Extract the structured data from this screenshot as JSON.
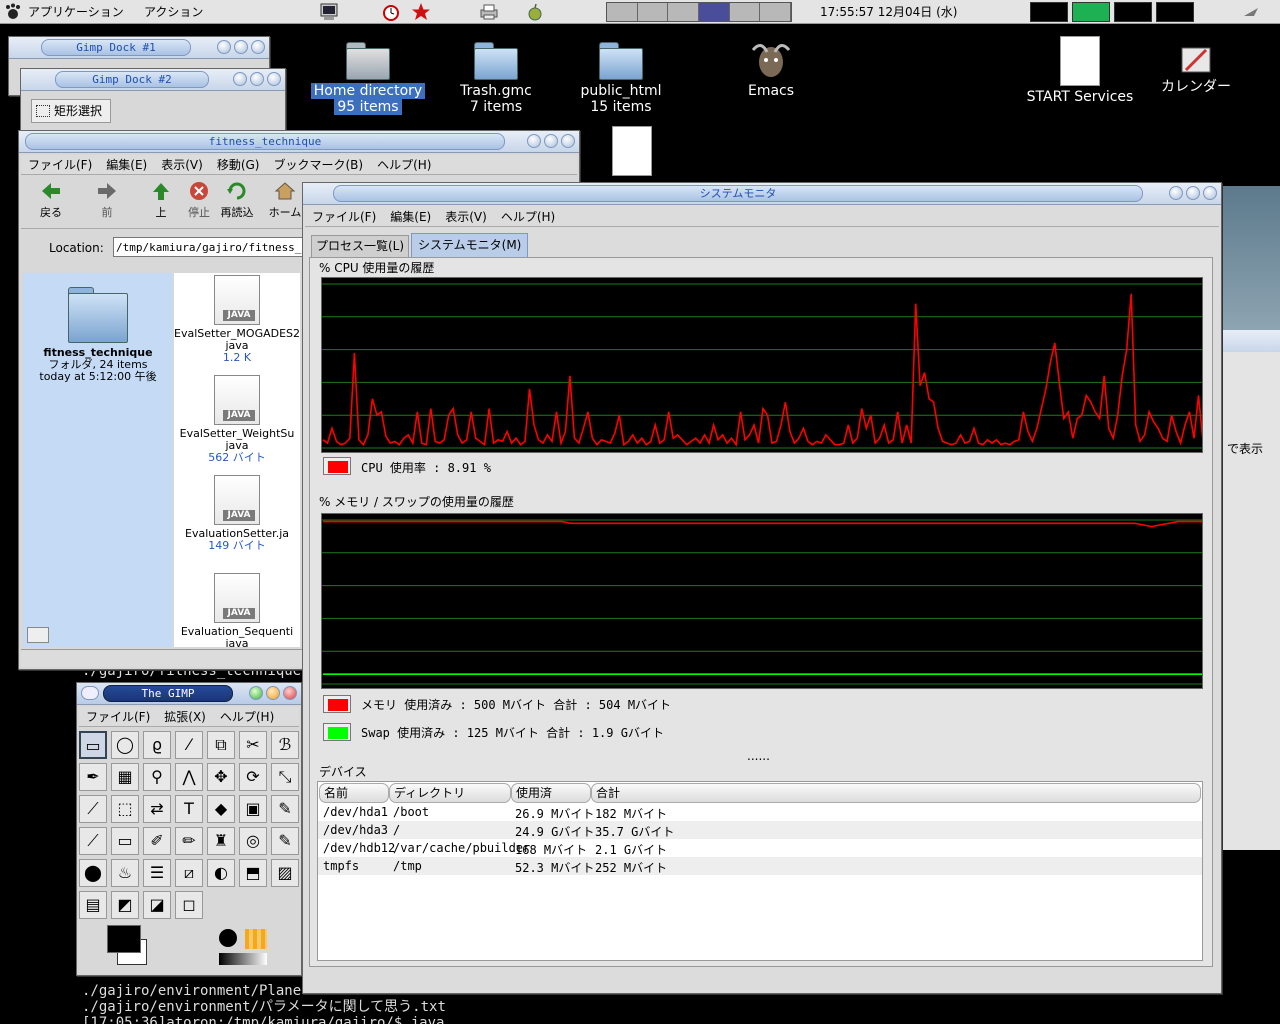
{
  "panel": {
    "applications": "アプリケーション",
    "actions": "アクション",
    "clock": "17:55:57 12月04日 (水)"
  },
  "desktop": {
    "icons": [
      {
        "name": "Home directory",
        "sub": "95 items"
      },
      {
        "name": "Trash.gmc",
        "sub": "7 items"
      },
      {
        "name": "public_html",
        "sub": "15 items"
      },
      {
        "name": "Emacs"
      },
      {
        "name": "START Services"
      },
      {
        "name": "カレンダー"
      }
    ],
    "bg_text_right": "で表示"
  },
  "gimp_dock_1": {
    "title": "Gimp Dock #1"
  },
  "gimp_dock_2": {
    "title": "Gimp Dock #2",
    "tool_label": "矩形選択"
  },
  "file_manager": {
    "title": "fitness_technique",
    "menu": [
      "ファイル(F)",
      "編集(E)",
      "表示(V)",
      "移動(G)",
      "ブックマーク(B)",
      "ヘルプ(H)"
    ],
    "toolbar": [
      "戻る",
      "前",
      "上",
      "停止",
      "再読込",
      "ホーム"
    ],
    "location_label": "Location:",
    "location_value": "/tmp/kamiura/gajiro/fitness_technique",
    "folder": {
      "name": "fitness_technique",
      "line1": "フォルダ, 24 items",
      "line2": "today at 5:12:00 午後"
    },
    "files": [
      {
        "name": "EvalSetter_MOGADES2",
        "ext": "java",
        "size": "1.2 K"
      },
      {
        "name": "EvalSetter_WeightSu",
        "ext": "java",
        "size": "562 バイト"
      },
      {
        "name": "EvaluationSetter.ja",
        "ext": "",
        "size": "149 バイト"
      },
      {
        "name": "Evaluation_Sequenti",
        "ext": "java",
        "size": ""
      }
    ],
    "java_badge": "JAVA"
  },
  "sysmon": {
    "title": "システムモニタ",
    "menu": [
      "ファイル(F)",
      "編集(E)",
      "表示(V)",
      "ヘルプ(H)"
    ],
    "tabs": [
      "プロセス一覧(L)",
      "システムモニタ(M)"
    ],
    "cpu_section": "% CPU 使用量の履歴",
    "cpu_legend": "CPU 使用率 : 8.91 %",
    "mem_section": "% メモリ / スワップの使用量の履歴",
    "mem_legend": "メモリ 使用済み : 500 Mバイト 合計 : 504 Mバイト",
    "swap_legend": "Swap 使用済み : 125 Mバイト 合計 : 1.9 Gバイト",
    "dots": "......",
    "devices_section": "デバイス",
    "columns": [
      "名前",
      "ディレクトリ",
      "使用済",
      "合計"
    ],
    "rows": [
      [
        "/dev/hda1",
        "/boot",
        "26.9 Mバイト",
        "182 Mバイト"
      ],
      [
        "/dev/hda3",
        "/",
        "24.9 Gバイト",
        "35.7 Gバイト"
      ],
      [
        "/dev/hdb12",
        "/var/cache/pbuilder",
        "168 Mバイト",
        "2.1 Gバイト"
      ],
      [
        "tmpfs",
        "/tmp",
        "52.3 Mバイト",
        "252 Mバイト"
      ]
    ],
    "colors": {
      "cpu": "#ff0000",
      "mem": "#ff0000",
      "swap": "#00ff00",
      "grid": "#1d7a1d"
    }
  },
  "chart_data": [
    {
      "type": "line",
      "title": "% CPU 使用量の履歴",
      "ylim": [
        0,
        100
      ],
      "grid": true,
      "series": [
        {
          "name": "CPU",
          "values": [
            5,
            3,
            12,
            4,
            2,
            3,
            6,
            58,
            5,
            2,
            8,
            30,
            20,
            22,
            7,
            3,
            4,
            2,
            6,
            8,
            3,
            22,
            3,
            2,
            24,
            4,
            3,
            5,
            20,
            24,
            8,
            3,
            5,
            22,
            6,
            4,
            2,
            24,
            3,
            5,
            4,
            10,
            3,
            6,
            2,
            4,
            36,
            14,
            5,
            3,
            8,
            4,
            22,
            3,
            10,
            44,
            6,
            3,
            12,
            22,
            6,
            2,
            5,
            4,
            3,
            9,
            20,
            2,
            4,
            8,
            3,
            6,
            2,
            4,
            14,
            3,
            5,
            22,
            6,
            8,
            5,
            2,
            4,
            6,
            3,
            8,
            3,
            14,
            5,
            8,
            3,
            6,
            2,
            22,
            5,
            8,
            14,
            3,
            24,
            20,
            3,
            4,
            14,
            28,
            10,
            3,
            6,
            12,
            4,
            2,
            4,
            3,
            8,
            5,
            2,
            2,
            3,
            14,
            3,
            6,
            24,
            12,
            20,
            3,
            6,
            14,
            3,
            5,
            22,
            3,
            14,
            3,
            88,
            38,
            46,
            30,
            28,
            12,
            4,
            3,
            2,
            3,
            8,
            3,
            4,
            12,
            3,
            2,
            5,
            3,
            5,
            2,
            3,
            2,
            4,
            5,
            22,
            10,
            4,
            12,
            24,
            36,
            52,
            64,
            40,
            18,
            22,
            6,
            18,
            20,
            32,
            28,
            22,
            18,
            44,
            12,
            6,
            20,
            44,
            60,
            94,
            14,
            4,
            8,
            22,
            16,
            12,
            6,
            4,
            20,
            10,
            3,
            14,
            22,
            6,
            32,
            4
          ]
        }
      ]
    },
    {
      "type": "line",
      "title": "% メモリ / スワップの使用量の履歴",
      "ylim": [
        0,
        100
      ],
      "grid": true,
      "series": [
        {
          "name": "メモリ",
          "values": [
            99,
            99,
            99,
            99,
            99,
            99,
            99,
            99,
            99,
            99,
            99,
            99,
            99,
            99,
            99,
            99,
            99,
            99,
            99,
            99,
            99,
            99,
            99,
            99,
            99,
            99,
            99,
            99,
            99,
            98,
            98,
            98,
            98,
            98,
            98,
            98,
            98,
            98,
            98,
            98,
            98,
            98,
            98,
            98,
            98,
            98,
            98,
            98,
            98,
            98,
            98,
            98,
            98,
            98,
            98,
            98,
            98,
            98,
            98,
            98,
            98,
            98,
            98,
            98,
            98,
            98,
            98,
            98,
            98,
            98,
            98,
            98,
            98,
            98,
            98,
            98,
            98,
            98,
            98,
            98,
            98,
            98,
            98,
            98,
            98,
            98,
            98,
            98,
            98,
            98,
            98,
            98,
            98,
            98,
            98,
            98,
            97,
            96,
            97,
            98,
            99,
            99,
            99,
            99
          ]
        },
        {
          "name": "Swap",
          "values": [
            6,
            6,
            6,
            6,
            6,
            6,
            6,
            6,
            6,
            6,
            6,
            6,
            6,
            6,
            6,
            6,
            6,
            6,
            6,
            6,
            6,
            6,
            6,
            6,
            6,
            6,
            6,
            6,
            6,
            6,
            6,
            6,
            6,
            6,
            6,
            6,
            6,
            6,
            6,
            6,
            6,
            6,
            6,
            6,
            6,
            6,
            6,
            6,
            6,
            6,
            6,
            6,
            6,
            6,
            6,
            6,
            6,
            6,
            6,
            6,
            6,
            6,
            6,
            6,
            6,
            6,
            6,
            6,
            6,
            6,
            6,
            6,
            6,
            6,
            6,
            6,
            6,
            6,
            6,
            6,
            6,
            6,
            6,
            6,
            6,
            6,
            6,
            6,
            6,
            6,
            6,
            6,
            6,
            6,
            6,
            6,
            6,
            6,
            6,
            6,
            6,
            6,
            6,
            6
          ]
        }
      ]
    }
  ],
  "gimp": {
    "title": "The GIMP",
    "menu": [
      "ファイル(F)",
      "拡張(X)",
      "ヘルプ(H)"
    ]
  },
  "terminal": {
    "lines": [
      "./gajiro/fitness_technique/",
      "./gajiro/environment/Planet",
      "./gajiro/environment/パラメータに関して思う.txt",
      "[17:05:36]atoron:/tmp/kamiura/gajiro/$ java"
    ]
  }
}
